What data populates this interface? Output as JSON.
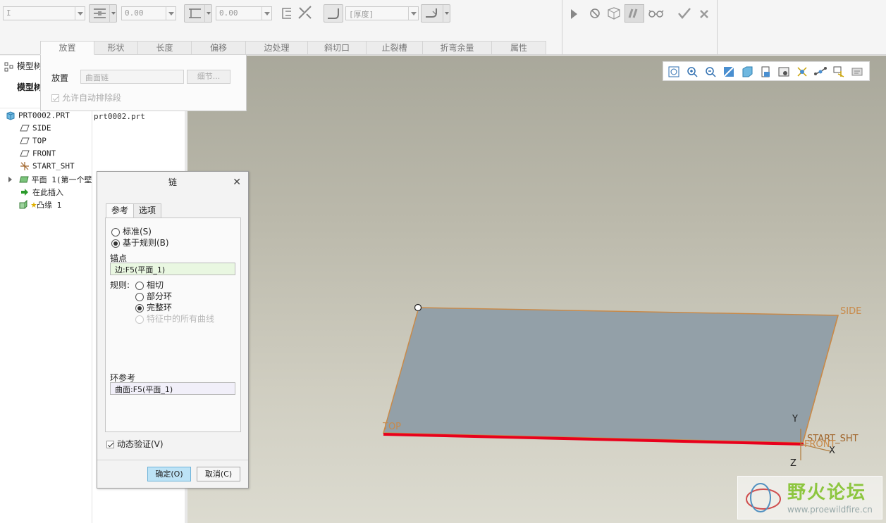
{
  "ribbon": {
    "combo1_value": "I",
    "thickness_value": "0.00",
    "offset_value": "0.00",
    "thickness_combo": "[厚度]",
    "tabs": [
      "放置",
      "形状",
      "长度",
      "偏移",
      "边处理",
      "斜切口",
      "止裂槽",
      "折弯余量",
      "属性"
    ]
  },
  "placement": {
    "label": "放置",
    "chain_placeholder": "曲面链",
    "details_button": "细节...",
    "auto_exclude": "允许自动排除段"
  },
  "left_panel": {
    "header": "模型树",
    "subheader": "模型树",
    "file_name": "prt0002.prt",
    "tree": [
      {
        "label": "PRT0002.PRT",
        "icon": "part-icon"
      },
      {
        "label": "SIDE",
        "icon": "datum-plane-icon"
      },
      {
        "label": "TOP",
        "icon": "datum-plane-icon"
      },
      {
        "label": "FRONT",
        "icon": "datum-plane-icon"
      },
      {
        "label": "START_SHT",
        "icon": "csys-icon"
      },
      {
        "label": "平面 1(第一个壁",
        "icon": "planar-wall-icon"
      },
      {
        "label": "在此插入",
        "icon": "insert-here-arrow-icon"
      },
      {
        "label": "凸缘 1",
        "icon": "flange-icon"
      }
    ]
  },
  "chain_dialog": {
    "title": "链",
    "tabs": [
      "参考",
      "选项"
    ],
    "radio_standard": "标准(S)",
    "radio_rule": "基于规则(B)",
    "anchor_label": "锚点",
    "anchor_value": "边:F5(平面_1)",
    "rule_label": "规则:",
    "rules": [
      "相切",
      "部分环",
      "完整环",
      "特征中的所有曲线"
    ],
    "loop_ref_label": "环参考",
    "loop_ref_value": "曲面:F5(平面_1)",
    "dynamic_validation": "动态验证(V)",
    "ok": "确定(O)",
    "cancel": "取消(C)"
  },
  "viewport": {
    "labels": {
      "side": "SIDE",
      "top": "TOP",
      "start": "START_SHT",
      "front": "FRONT",
      "x": "X",
      "y": "Y",
      "z": "Z"
    }
  },
  "watermark": {
    "title": "野火论坛",
    "url": "www.proewildfire.cn"
  },
  "colors": {
    "accent": "#6eb3d9",
    "edge_highlight": "#e8001c",
    "datum": "#c98a3a"
  }
}
